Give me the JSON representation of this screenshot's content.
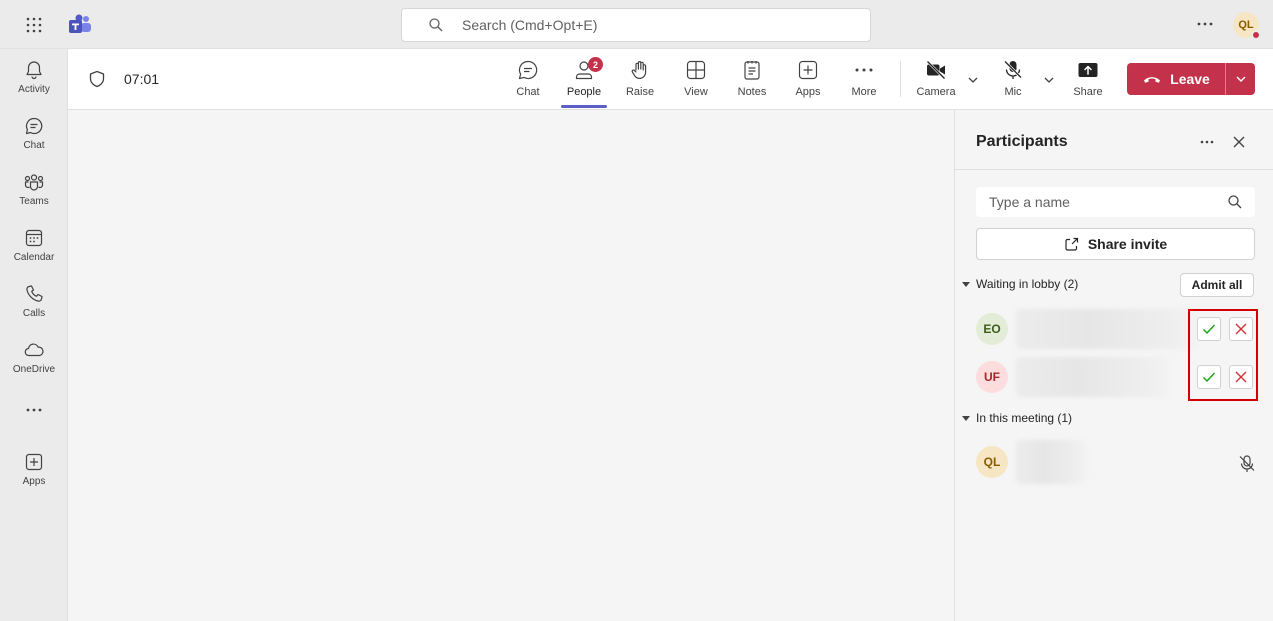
{
  "app": {
    "search_placeholder": "Search (Cmd+Opt+E)",
    "user_initials": "QL"
  },
  "rail": [
    {
      "label": "Activity",
      "icon": "bell-icon"
    },
    {
      "label": "Chat",
      "icon": "chat-icon"
    },
    {
      "label": "Teams",
      "icon": "teams-icon"
    },
    {
      "label": "Calendar",
      "icon": "calendar-icon"
    },
    {
      "label": "Calls",
      "icon": "phone-icon"
    },
    {
      "label": "OneDrive",
      "icon": "cloud-icon"
    },
    {
      "label": "Apps",
      "icon": "plus-square-icon"
    }
  ],
  "meeting": {
    "timer": "07:01",
    "tools": {
      "chat": "Chat",
      "people": "People",
      "people_badge": "2",
      "raise": "Raise",
      "view": "View",
      "notes": "Notes",
      "apps": "Apps",
      "more": "More",
      "camera": "Camera",
      "mic": "Mic",
      "share": "Share"
    },
    "leave_label": "Leave",
    "accent_color": "#5b5fc7",
    "leave_color": "#c4314b"
  },
  "participants": {
    "title": "Participants",
    "search_placeholder": "Type a name",
    "share_invite": "Share invite",
    "lobby_header": "Waiting in lobby (2)",
    "admit_all": "Admit all",
    "lobby": [
      {
        "initials": "EO"
      },
      {
        "initials": "UF"
      }
    ],
    "meeting_header": "In this meeting (1)",
    "in_meeting": [
      {
        "initials": "QL"
      }
    ]
  }
}
